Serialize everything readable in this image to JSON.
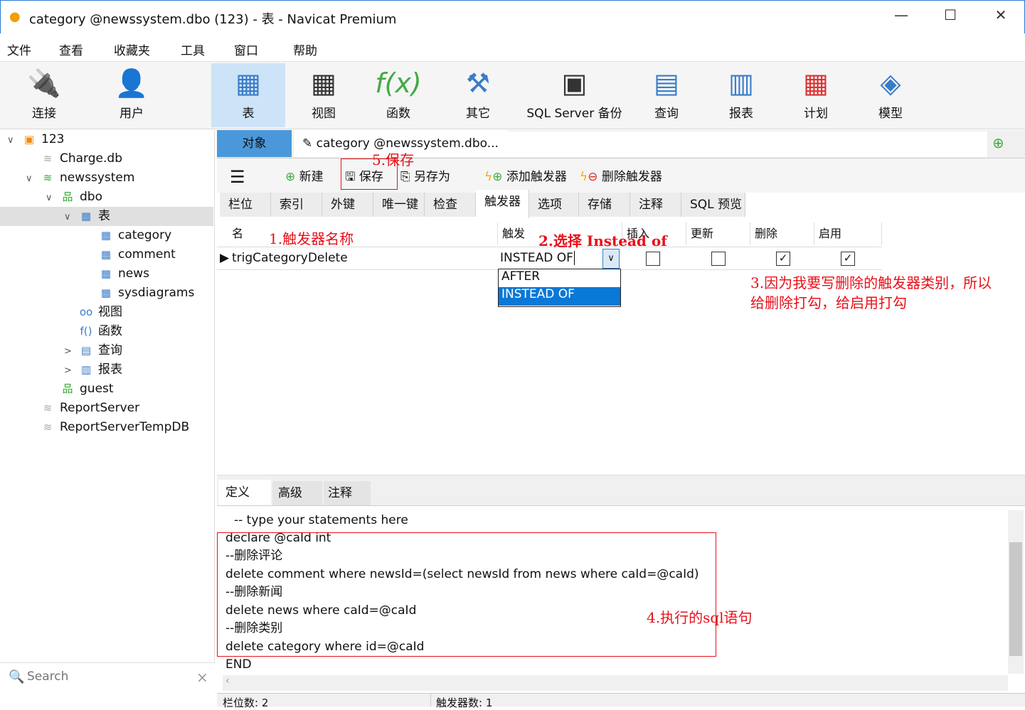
{
  "window": {
    "title": "category @newssystem.dbo (123) - 表 - Navicat Premium",
    "minimize": "—",
    "maximize": "☐",
    "close": "✕"
  },
  "menu": [
    "文件",
    "查看",
    "收藏夹",
    "工具",
    "窗口",
    "帮助"
  ],
  "toolbar": [
    {
      "label": "连接",
      "icon": "plug-icon"
    },
    {
      "label": "用户",
      "icon": "user-icon"
    },
    {
      "label": "表",
      "icon": "table-icon"
    },
    {
      "label": "视图",
      "icon": "view-icon"
    },
    {
      "label": "函数",
      "icon": "function-icon"
    },
    {
      "label": "其它",
      "icon": "tools-icon"
    },
    {
      "label": "SQL Server 备份",
      "icon": "backup-icon"
    },
    {
      "label": "查询",
      "icon": "query-icon"
    },
    {
      "label": "报表",
      "icon": "report-icon"
    },
    {
      "label": "计划",
      "icon": "schedule-icon"
    },
    {
      "label": "模型",
      "icon": "model-icon"
    }
  ],
  "tree": [
    {
      "label": "123",
      "level": 0,
      "arrow": "∨",
      "icon": "▣"
    },
    {
      "label": "Charge.db",
      "level": 1,
      "arrow": "",
      "icon": "≋"
    },
    {
      "label": "newssystem",
      "level": 1,
      "arrow": "∨",
      "icon": "≋"
    },
    {
      "label": "dbo",
      "level": 2,
      "arrow": "∨",
      "icon": "品"
    },
    {
      "label": "表",
      "level": 3,
      "arrow": "∨",
      "icon": "▦"
    },
    {
      "label": "category",
      "level": 4,
      "arrow": "",
      "icon": "▦"
    },
    {
      "label": "comment",
      "level": 4,
      "arrow": "",
      "icon": "▦"
    },
    {
      "label": "news",
      "level": 4,
      "arrow": "",
      "icon": "▦"
    },
    {
      "label": "sysdiagrams",
      "level": 4,
      "arrow": "",
      "icon": "▦"
    },
    {
      "label": "视图",
      "level": 3,
      "arrow": "",
      "icon": "oo"
    },
    {
      "label": "函数",
      "level": 3,
      "arrow": "",
      "icon": "f()"
    },
    {
      "label": "查询",
      "level": 3,
      "arrow": ">",
      "icon": "▤"
    },
    {
      "label": "报表",
      "level": 3,
      "arrow": ">",
      "icon": "▥"
    },
    {
      "label": "guest",
      "level": 2,
      "arrow": "",
      "icon": "品"
    },
    {
      "label": "ReportServer",
      "level": 1,
      "arrow": "",
      "icon": "≋"
    },
    {
      "label": "ReportServerTempDB",
      "level": 1,
      "arrow": "",
      "icon": "≋"
    }
  ],
  "search": {
    "placeholder": "Search",
    "clear": "×"
  },
  "tabs": {
    "objects": "对象",
    "active": "category @newssystem.dbo..."
  },
  "actions": {
    "new": "新建",
    "save": "保存",
    "save_as": "另存为",
    "add_trigger": "添加触发器",
    "delete_trigger": "删除触发器"
  },
  "subtabs": [
    "栏位",
    "索引",
    "外键",
    "唯一键",
    "检查",
    "触发器",
    "选项",
    "存储",
    "注释",
    "SQL 预览"
  ],
  "grid": {
    "headers": [
      "名",
      "触发",
      "插入",
      "更新",
      "删除",
      "启用"
    ],
    "row": {
      "name": "trigCategoryDelete",
      "fire": "INSTEAD OF",
      "insert": false,
      "update": false,
      "delete": true,
      "enabled": true
    },
    "dropdown_options": [
      "AFTER",
      "INSTEAD OF"
    ],
    "dropdown_selected": "INSTEAD OF"
  },
  "annotations": {
    "a1": "1.触发器名称",
    "a2": "2.选择 Instead of",
    "a3_line1": "3.因为我要写删除的触发器类别，所以",
    "a3_line2": "给删除打勾，给启用打勾",
    "a4": "4.执行的sql语句",
    "a5": "5.保存"
  },
  "deftabs": [
    "定义",
    "高级",
    "注释"
  ],
  "code": [
    "-- type your statements here",
    "declare @caId int",
    "--删除评论",
    "delete comment where newsId=(select newsId from news where caId=@caId)",
    "--删除新闻",
    "delete news where caId=@caId",
    "--删除类别",
    "delete category where id=@caId",
    "END"
  ],
  "status": {
    "fields": "栏位数: 2",
    "triggers": "触发器数: 1"
  }
}
